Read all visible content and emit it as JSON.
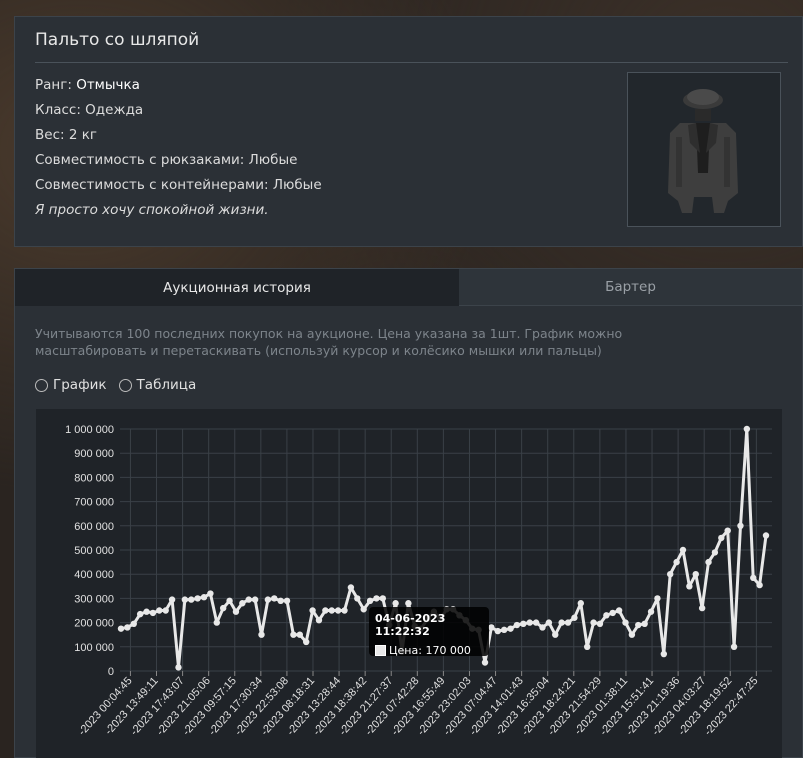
{
  "item": {
    "title": "Пальто со шляпой",
    "rank_label": "Ранг: ",
    "rank_value": "Отмычка",
    "class_text": "Класс: Одежда",
    "weight_text": "Вес: 2 кг",
    "backpack_compat": "Совместимость с рюкзаками: Любые",
    "container_compat": "Совместимость с контейнерами: Любые",
    "description": "Я просто хочу спокойной жизни."
  },
  "tabs": [
    {
      "label": "Аукционная история",
      "active": true
    },
    {
      "label": "Бартер",
      "active": false
    }
  ],
  "info_text": "Учитываются 100 последних покупок на аукционе. Цена указана за 1шт. График можно масштабировать и перетаскивать (используй курсор и колёсико мышки или пальцы)",
  "view_options": [
    "График",
    "Таблица"
  ],
  "tooltip": {
    "title": "04-06-2023 11:22:32",
    "label": "Цена: 170 000"
  },
  "colors": {
    "line": "#e8e8e8",
    "grid": "#3a4047",
    "chart_bg": "#1f2328",
    "panel_bg": "#2b3036"
  },
  "chart_data": {
    "type": "line",
    "ylim": [
      0,
      1000000
    ],
    "y_ticks": [
      "0",
      "100 000",
      "200 000",
      "300 000",
      "400 000",
      "500 000",
      "600 000",
      "700 000",
      "800 000",
      "900 000",
      "1 000 000"
    ],
    "x_tick_labels": [
      "-2023 00:04:45",
      "-2023 13:49:11",
      "-2023 17:43:07",
      "-2023 21:05:06",
      "-2023 09:57:15",
      "-2023 17:30:34",
      "-2023 22:53:08",
      "-2023 08:18:31",
      "-2023 13:28:44",
      "-2023 18:38:42",
      "-2023 21:27:37",
      "-2023 07:42:28",
      "-2023 16:55:49",
      "-2023 23:02:03",
      "-2023 07:04:47",
      "-2023 14:01:43",
      "-2023 16:35:04",
      "-2023 18:24:21",
      "-2023 21:54:29",
      "-2023 01:38:11",
      "-2023 15:51:41",
      "-2023 21:19:36",
      "-2023 04:03:27",
      "-2023 18:19:52",
      "-2023 22:47:25"
    ],
    "series": [
      {
        "values": [
          175000,
          180000,
          195000,
          235000,
          245000,
          240000,
          250000,
          250000,
          295000,
          15000,
          295000,
          295000,
          300000,
          305000,
          320000,
          200000,
          260000,
          290000,
          245000,
          280000,
          295000,
          295000,
          150000,
          295000,
          300000,
          290000,
          290000,
          150000,
          150000,
          120000,
          250000,
          210000,
          250000,
          250000,
          250000,
          250000,
          345000,
          300000,
          255000,
          290000,
          300000,
          300000,
          190000,
          280000,
          80000,
          280000,
          185000,
          175000,
          215000,
          245000,
          215000,
          255000,
          255000,
          230000,
          210000,
          175000,
          170000,
          35000,
          180000,
          165000,
          170000,
          175000,
          190000,
          195000,
          200000,
          200000,
          180000,
          200000,
          150000,
          200000,
          200000,
          220000,
          280000,
          100000,
          200000,
          195000,
          230000,
          240000,
          250000,
          200000,
          150000,
          190000,
          195000,
          245000,
          300000,
          70000,
          400000,
          450000,
          500000,
          350000,
          400000,
          260000,
          450000,
          490000,
          550000,
          580000,
          100000,
          600000,
          1000000,
          385000,
          355000,
          560000
        ]
      }
    ]
  }
}
